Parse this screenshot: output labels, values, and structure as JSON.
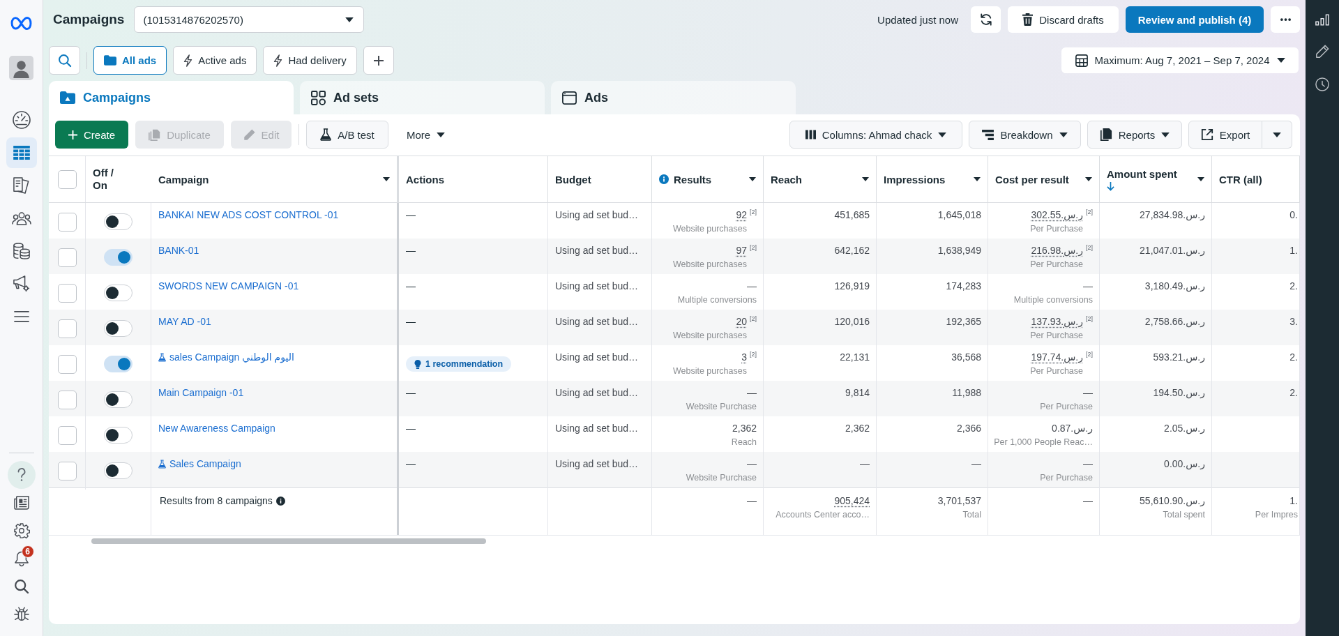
{
  "left_nav": {
    "items": [
      {
        "selected": false
      },
      {
        "selected": true
      },
      {
        "selected": false
      },
      {
        "selected": false
      },
      {
        "selected": false
      },
      {
        "selected": false
      },
      {
        "selected": false
      }
    ],
    "alert_count": "6"
  },
  "header": {
    "title": "Campaigns",
    "account": "(1015314876202570)",
    "status": "Updated just now",
    "discard_label": "Discard drafts",
    "publish_label": "Review and publish (4)"
  },
  "filters": {
    "presets": [
      {
        "label": "All ads",
        "selected": true
      },
      {
        "label": "Active ads",
        "selected": false
      },
      {
        "label": "Had delivery",
        "selected": false
      }
    ],
    "date_range": "Maximum: Aug 7, 2021 – Sep 7, 2024"
  },
  "tabs": [
    {
      "label": "Campaigns",
      "selected": true
    },
    {
      "label": "Ad sets",
      "selected": false
    },
    {
      "label": "Ads",
      "selected": false
    }
  ],
  "toolbar": {
    "actions": [
      {
        "label": "Create",
        "kind": "primary",
        "disabled": false
      },
      {
        "label": "Duplicate",
        "kind": "default",
        "disabled": true
      },
      {
        "label": "Edit",
        "kind": "default",
        "disabled": true
      },
      {
        "label": "A/B test",
        "kind": "default",
        "disabled": false
      },
      {
        "label": "More",
        "kind": "menu",
        "disabled": false
      }
    ],
    "view_options": [
      {
        "label": "Columns: Ahmad chack",
        "kind": "dropdown"
      },
      {
        "label": "Breakdown",
        "kind": "dropdown"
      },
      {
        "label": "Reports",
        "kind": "dropdown"
      },
      {
        "label": "Export",
        "kind": "split"
      }
    ]
  },
  "table": {
    "all_checked": false,
    "columns": [
      {
        "label": "Off / On",
        "menu": false,
        "info": false,
        "sorted": false
      },
      {
        "label": "Campaign",
        "menu": true,
        "info": false,
        "sorted": false
      },
      {
        "label": "Actions",
        "menu": false,
        "info": false,
        "sorted": false
      },
      {
        "label": "Budget",
        "menu": false,
        "info": false,
        "sorted": false
      },
      {
        "label": "Results",
        "menu": true,
        "info": true,
        "sorted": false
      },
      {
        "label": "Reach",
        "menu": true,
        "info": false,
        "sorted": false
      },
      {
        "label": "Impressions",
        "menu": true,
        "info": false,
        "sorted": false
      },
      {
        "label": "Cost per result",
        "menu": true,
        "info": false,
        "sorted": false
      },
      {
        "label": "Amount spent",
        "menu": true,
        "info": false,
        "sorted": true
      },
      {
        "label": "CTR (all)",
        "menu": false,
        "info": false,
        "sorted": false
      }
    ],
    "rows": [
      {
        "checked": false,
        "on": false,
        "name": "BANKAI NEW ADS COST CONTROL -01",
        "ab_test": false,
        "actions": {
          "kind": "dash",
          "text": "—"
        },
        "budget": "Using ad set bud…",
        "results": {
          "value": "92",
          "note": "[2]",
          "label": "Website purchases",
          "dotted": true
        },
        "reach": "451,685",
        "impressions": "1,645,018",
        "cost": {
          "value": "302.55.ر.س",
          "note": "[2]",
          "label": "Per Purchase",
          "dotted": true
        },
        "spent": "27,834.98.ر.س",
        "ctr": "0."
      },
      {
        "checked": false,
        "on": true,
        "name": "BANK-01",
        "ab_test": false,
        "actions": {
          "kind": "dash",
          "text": "—"
        },
        "budget": "Using ad set bud…",
        "results": {
          "value": "97",
          "note": "[2]",
          "label": "Website purchases",
          "dotted": true
        },
        "reach": "642,162",
        "impressions": "1,638,949",
        "cost": {
          "value": "216.98.ر.س",
          "note": "[2]",
          "label": "Per Purchase",
          "dotted": true
        },
        "spent": "21,047.01.ر.س",
        "ctr": "1."
      },
      {
        "checked": false,
        "on": false,
        "name": "SWORDS NEW CAMPAIGN -01",
        "ab_test": false,
        "actions": {
          "kind": "dash",
          "text": "—"
        },
        "budget": "Using ad set bud…",
        "results": {
          "value": "—",
          "label": "Multiple conversions",
          "dotted": false
        },
        "reach": "126,919",
        "impressions": "174,283",
        "cost": {
          "value": "—",
          "label": "Multiple conversions",
          "dotted": false
        },
        "spent": "3,180.49.ر.س",
        "ctr": "2."
      },
      {
        "checked": false,
        "on": false,
        "name": "MAY AD -01",
        "ab_test": false,
        "actions": {
          "kind": "dash",
          "text": "—"
        },
        "budget": "Using ad set bud…",
        "results": {
          "value": "20",
          "note": "[2]",
          "label": "Website purchases",
          "dotted": true
        },
        "reach": "120,016",
        "impressions": "192,365",
        "cost": {
          "value": "137.93.ر.س",
          "note": "[2]",
          "label": "Per Purchase",
          "dotted": true
        },
        "spent": "2,758.66.ر.س",
        "ctr": "3."
      },
      {
        "checked": false,
        "on": true,
        "name": "sales Campaign اليوم الوطني",
        "ab_test": true,
        "actions": {
          "kind": "recommendation",
          "text": "1 recommendation"
        },
        "budget": "Using ad set bud…",
        "results": {
          "value": "3",
          "note": "[2]",
          "label": "Website purchases",
          "dotted": true
        },
        "reach": "22,131",
        "impressions": "36,568",
        "cost": {
          "value": "197.74.ر.س",
          "note": "[2]",
          "label": "Per Purchase",
          "dotted": true
        },
        "spent": "593.21.ر.س",
        "ctr": "2."
      },
      {
        "checked": false,
        "on": false,
        "name": "Main Campaign -01",
        "ab_test": false,
        "actions": {
          "kind": "dash",
          "text": "—"
        },
        "budget": "Using ad set bud…",
        "results": {
          "value": "—",
          "label": "Website Purchase",
          "dotted": false
        },
        "reach": "9,814",
        "impressions": "11,988",
        "cost": {
          "value": "—",
          "label": "Per Purchase",
          "dotted": false
        },
        "spent": "194.50.ر.س",
        "ctr": "2."
      },
      {
        "checked": false,
        "on": false,
        "name": "New Awareness Campaign",
        "ab_test": false,
        "actions": {
          "kind": "dash",
          "text": "—"
        },
        "budget": "Using ad set bud…",
        "results": {
          "value": "2,362",
          "label": "Reach",
          "dotted": false
        },
        "reach": "2,362",
        "impressions": "2,366",
        "cost": {
          "value": "0.87.ر.س",
          "label": "Per 1,000 People Reac…",
          "dotted": false
        },
        "spent": "2.05.ر.س"
      },
      {
        "checked": false,
        "on": false,
        "name": "Sales Campaign",
        "ab_test": true,
        "actions": {
          "kind": "dash",
          "text": "—"
        },
        "budget": "Using ad set bud…",
        "results": {
          "value": "—",
          "label": "Website Purchase",
          "dotted": false
        },
        "reach": "—",
        "impressions": "—",
        "cost": {
          "value": "—",
          "label": "Per Purchase",
          "dotted": false
        },
        "spent": "0.00.ر.س"
      }
    ],
    "summary": {
      "label": "Results from 8 campaigns",
      "results": {
        "value": "—"
      },
      "reach": {
        "value": "905,424",
        "label": "Accounts Center acco…",
        "dotted": true
      },
      "impressions": {
        "value": "3,701,537",
        "label": "Total"
      },
      "cost": {
        "value": "—"
      },
      "spent": {
        "value": "55,610.90.ر.س",
        "label": "Total spent"
      },
      "ctr": {
        "value": "1.",
        "label": "Per Impres"
      }
    }
  }
}
